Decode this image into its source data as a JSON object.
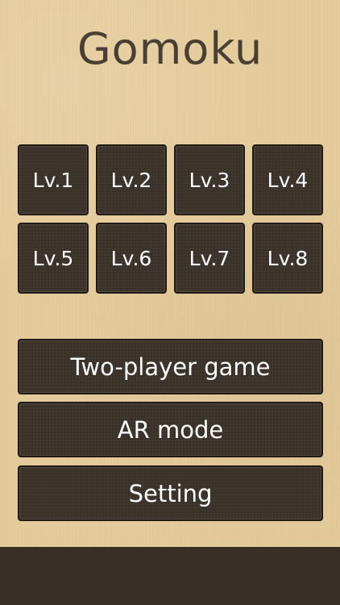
{
  "title": "Gomoku",
  "levels": [
    "Lv.1",
    "Lv.2",
    "Lv.3",
    "Lv.4",
    "Lv.5",
    "Lv.6",
    "Lv.7",
    "Lv.8"
  ],
  "modes": {
    "two_player": "Two-player game",
    "ar_mode": "AR mode",
    "setting": "Setting"
  },
  "colors": {
    "background": "#e5cc9c",
    "button": "#3b322a",
    "button_text": "#ffffff",
    "title": "#4a3f34",
    "bottom_bar": "#392f27"
  }
}
